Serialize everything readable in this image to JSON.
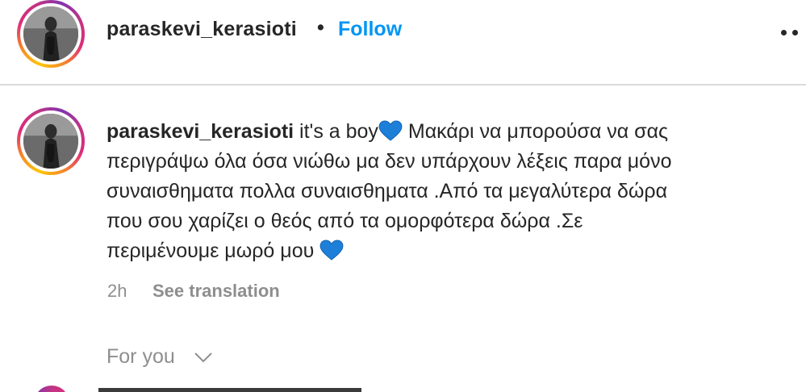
{
  "post": {
    "username": "paraskevi_kerasioti",
    "separator": "•",
    "follow_label": "Follow",
    "more_icon": "more-options-icon"
  },
  "caption": {
    "username": "paraskevi_kerasioti",
    "line1_text": " it's a boy",
    "line1_rest": " Μακάρι να μπορούσα να σας",
    "line2": "περιγράψω όλα όσα νιώθω μα δεν υπάρχουν λέξεις παρα μόνο",
    "line3": "συναισθηματα πολλα συναισθηματα .Από τα μεγαλύτερα δώρα",
    "line4": "που σου χαρίζει ο θεός από τα ομορφότερα δώρα .Σε",
    "line5": "περιμένουμε μωρό μου ",
    "emoji": "blue-heart-icon",
    "time": "2h",
    "see_translation": "See translation"
  },
  "feed": {
    "for_you_label": "For you"
  },
  "colors": {
    "link_blue": "#0095f6",
    "heart_blue": "#1d7fd8",
    "text": "#262626",
    "muted": "#8e8e8e"
  }
}
